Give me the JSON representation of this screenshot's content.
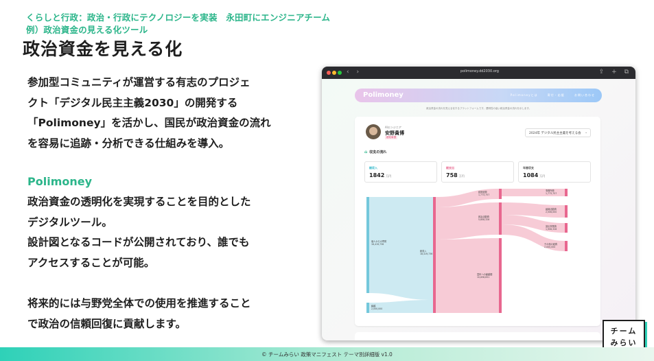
{
  "header": {
    "breadcrumb_1": "くらしと行政：政治・行政にテクノロジーを実装　永田町にエンジニアチーム",
    "breadcrumb_2": "例）政治資金の見える化ツール",
    "title": "政治資金を見える化"
  },
  "body": {
    "paragraph_1": [
      "参加型コミュニティが運営する有志のプロジェ",
      "クト「デジタル民主主義2030」の開発する",
      "「Polimoney」を活かし、国民が政治資金の流れ",
      "を容易に追跡・分析できる仕組みを導入。"
    ],
    "subheading": "Polimoney",
    "paragraph_2": [
      "政治資金の透明化を実現することを目的とした",
      "デジタルツール。",
      "設計図となるコードが公開されており、誰でも",
      "アクセスすることが可能。"
    ],
    "paragraph_3": [
      "将来的には与野党全体での使用を推進すること",
      "で政治の信頼回復に貢献します。"
    ]
  },
  "browser": {
    "url": "polimoney.dd2030.org",
    "nav_icons": "‹ ›",
    "right_icons": "⇪ + ⧉",
    "site_logo": "Polimoney",
    "site_nav": "Polimoneyとは 寄付・応援 お問い合わせ",
    "tagline": "政治資金の流れを見える化するプラットフォームです。透明性の高い政治資金の流れを示します。",
    "politician": {
      "subtitle": "AIエンジニア",
      "name": "安野貴博",
      "tag": "都知事選"
    },
    "report_select": "2024年 デジタル民主主義を考える会",
    "section_title": "収支の流れ",
    "stats": [
      {
        "label": "総収入",
        "value": "1842",
        "unit": "万円",
        "color": "#2bb5c8"
      },
      {
        "label": "総支出",
        "value": "758",
        "unit": "万円",
        "color": "#e8678f"
      },
      {
        "label": "年間収支",
        "value": "1084",
        "unit": "万円",
        "color": "#555555"
      }
    ],
    "sankey": {
      "sources": [
        {
          "label": "個人からの寄附",
          "value": "16,419,736"
        },
        {
          "label": "繰越",
          "value": "2,000,000"
        }
      ],
      "middle": {
        "label": "総収入",
        "value": "18,419,736"
      },
      "outflows": [
        {
          "label": "経常経費",
          "value": "1,773,757"
        },
        {
          "label": "政治活動費",
          "value": "5,808,328"
        },
        {
          "label": "翌年への繰越額",
          "value": "10,838,651"
        }
      ],
      "details": [
        {
          "label": "事務所費",
          "value": "1,773,757"
        },
        {
          "label": "組織活動費",
          "value": "2,506,000"
        },
        {
          "label": "宣伝事業費",
          "value": "1,908,328"
        },
        {
          "label": "その他の経費",
          "value": "2,000,000"
        }
      ]
    }
  },
  "footer": {
    "text": "© チームみらい 政策マニフェスト テーマ別詳細版 v1.0"
  },
  "team_logo": {
    "line_1": "チーム",
    "line_2": "みらい"
  },
  "colors": {
    "accent": "#2bb58a",
    "footer_gradient_start": "#2ed1b8",
    "sankey_blue": "#74c8dc",
    "sankey_pink": "#e8678f"
  }
}
